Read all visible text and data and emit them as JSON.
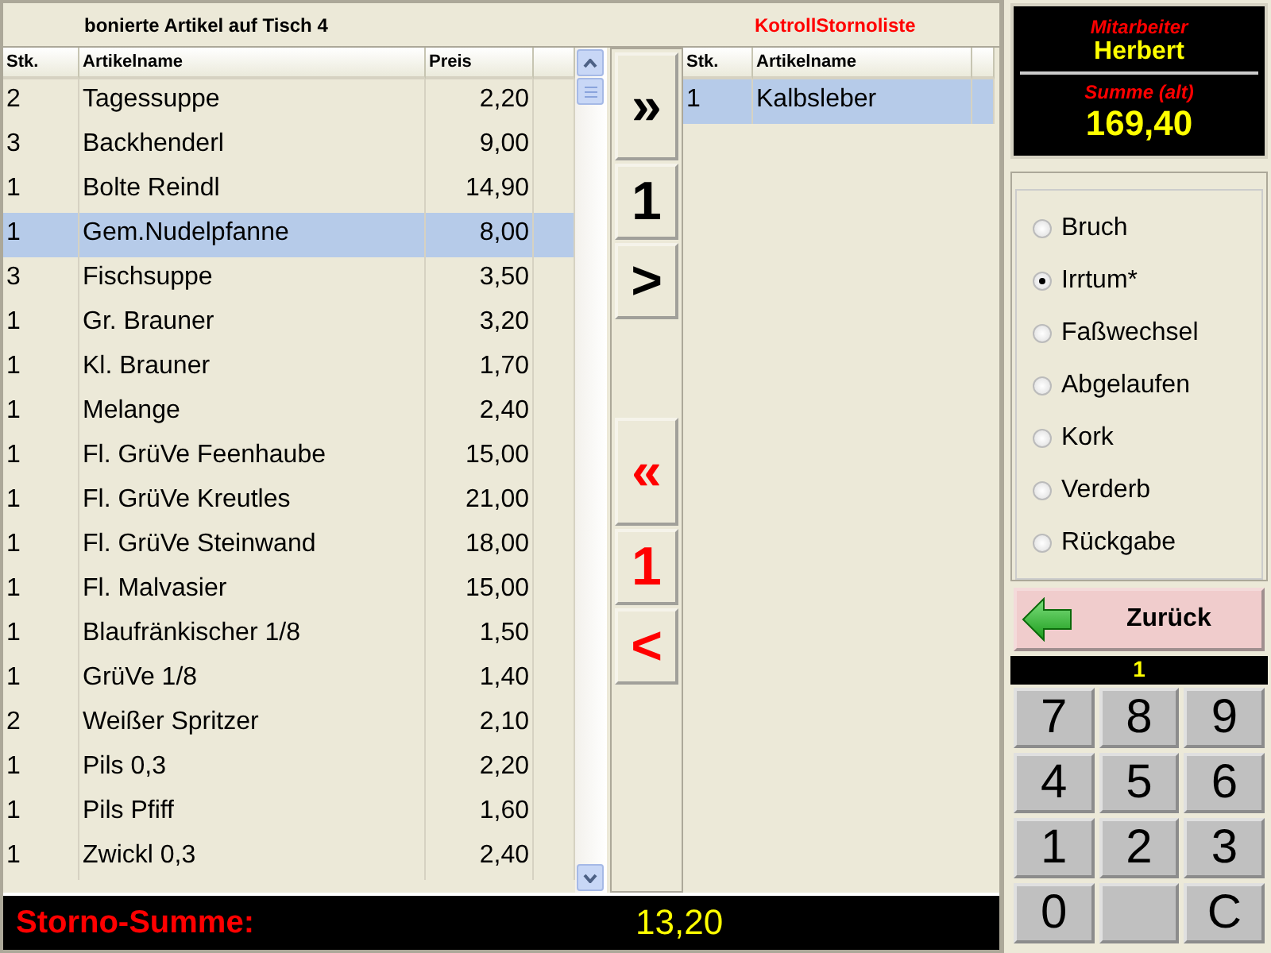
{
  "booked_list": {
    "title": "bonierte Artikel auf Tisch 4",
    "columns": [
      "Stk.",
      "Artikelname",
      "Preis"
    ],
    "rows": [
      {
        "qty": "2",
        "name": "Tagessuppe",
        "price": "2,20",
        "selected": false
      },
      {
        "qty": "3",
        "name": "Backhenderl",
        "price": "9,00",
        "selected": false
      },
      {
        "qty": "1",
        "name": "Bolte Reindl",
        "price": "14,90",
        "selected": false
      },
      {
        "qty": "1",
        "name": "Gem.Nudelpfanne",
        "price": "8,00",
        "selected": true
      },
      {
        "qty": "3",
        "name": "Fischsuppe",
        "price": "3,50",
        "selected": false
      },
      {
        "qty": "1",
        "name": "Gr. Brauner",
        "price": "3,20",
        "selected": false
      },
      {
        "qty": "1",
        "name": "Kl. Brauner",
        "price": "1,70",
        "selected": false
      },
      {
        "qty": "1",
        "name": "Melange",
        "price": "2,40",
        "selected": false
      },
      {
        "qty": "1",
        "name": "Fl. GrüVe Feenhaube",
        "price": "15,00",
        "selected": false
      },
      {
        "qty": "1",
        "name": "Fl. GrüVe Kreutles",
        "price": "21,00",
        "selected": false
      },
      {
        "qty": "1",
        "name": "Fl. GrüVe Steinwand",
        "price": "18,00",
        "selected": false
      },
      {
        "qty": "1",
        "name": "Fl. Malvasier",
        "price": "15,00",
        "selected": false
      },
      {
        "qty": "1",
        "name": "Blaufränkischer 1/8",
        "price": "1,50",
        "selected": false
      },
      {
        "qty": "1",
        "name": "GrüVe 1/8",
        "price": "1,40",
        "selected": false
      },
      {
        "qty": "2",
        "name": "Weißer Spritzer",
        "price": "2,10",
        "selected": false
      },
      {
        "qty": "1",
        "name": "Pils 0,3",
        "price": "2,20",
        "selected": false
      },
      {
        "qty": "1",
        "name": "Pils Pfiff",
        "price": "1,60",
        "selected": false
      },
      {
        "qty": "1",
        "name": "Zwickl 0,3",
        "price": "2,40",
        "selected": false
      }
    ]
  },
  "move_buttons": [
    {
      "label": "»",
      "kind": "add"
    },
    {
      "label": "1",
      "kind": "add"
    },
    {
      "label": ">",
      "kind": "add"
    },
    {
      "label": "«",
      "kind": "remove"
    },
    {
      "label": "1",
      "kind": "remove"
    },
    {
      "label": "<",
      "kind": "remove"
    }
  ],
  "storno_list": {
    "title": "KotrollStornoliste",
    "columns": [
      "Stk.",
      "Artikelname"
    ],
    "rows": [
      {
        "qty": "1",
        "name": "Kalbsleber",
        "selected": true
      }
    ]
  },
  "storno_total": {
    "label": "Storno-Summe:",
    "value": "13,20"
  },
  "info": {
    "employee_label": "Mitarbeiter",
    "employee": "Herbert",
    "sum_label": "Summe (alt)",
    "sum": "169,40"
  },
  "reasons": [
    {
      "label": "Bruch",
      "selected": false
    },
    {
      "label": "Irrtum*",
      "selected": true
    },
    {
      "label": "Faßwechsel",
      "selected": false
    },
    {
      "label": "Abgelaufen",
      "selected": false
    },
    {
      "label": "Kork",
      "selected": false
    },
    {
      "label": "Verderb",
      "selected": false
    },
    {
      "label": "Rückgabe",
      "selected": false
    }
  ],
  "back_button": "Zurück",
  "quantity_display": "1",
  "keypad": [
    {
      "kind": "key",
      "label": "7"
    },
    {
      "kind": "key",
      "label": "8"
    },
    {
      "kind": "key",
      "label": "9"
    },
    {
      "kind": "key",
      "label": "4"
    },
    {
      "kind": "key",
      "label": "5"
    },
    {
      "kind": "key",
      "label": "6"
    },
    {
      "kind": "key",
      "label": "1"
    },
    {
      "kind": "key",
      "label": "2"
    },
    {
      "kind": "key",
      "label": "3"
    },
    {
      "kind": "key",
      "label": "0"
    },
    {
      "kind": "blank"
    },
    {
      "kind": "key",
      "label": "C"
    }
  ]
}
